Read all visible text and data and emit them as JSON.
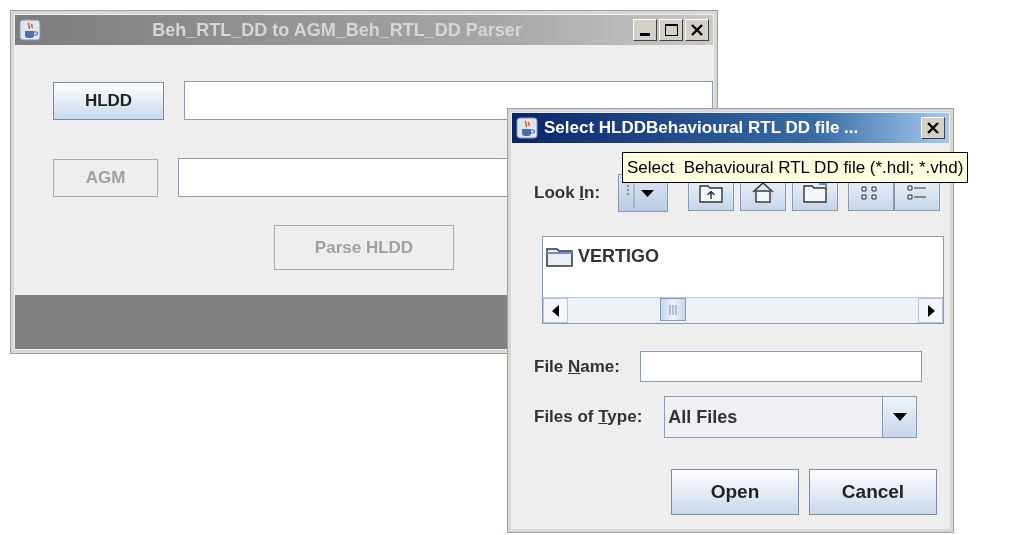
{
  "main_window": {
    "title": "Beh_RTL_DD to AGM_Beh_RTL_DD Parser",
    "active": false,
    "controls": [
      {
        "kind": "minimize"
      },
      {
        "kind": "maximize"
      },
      {
        "kind": "close"
      }
    ],
    "rows": [
      {
        "button": {
          "label": "HLDD",
          "disabled": false
        }
      },
      {
        "button": {
          "label": "AGM",
          "disabled": true
        }
      }
    ],
    "parse_button": {
      "label": "Parse HLDD",
      "disabled": true
    }
  },
  "dialog": {
    "title": "Select HLDDBehavioural RTL DD file ...",
    "active": true,
    "controls": [
      {
        "kind": "close"
      }
    ],
    "look_in": {
      "label": {
        "before": "Look ",
        "underlined": "I",
        "after": "n:"
      }
    },
    "toolbar": [
      {
        "kind": "up-folder"
      },
      {
        "kind": "home"
      },
      {
        "kind": "new-folder"
      },
      {
        "kind": "list"
      },
      {
        "kind": "details"
      }
    ],
    "files": [
      {
        "name": "VERTIGO",
        "kind": "folder"
      }
    ],
    "file_name": {
      "label": {
        "before": "File ",
        "underlined": "N",
        "after": "ame:"
      }
    },
    "file_type": {
      "label": {
        "before": "Files of ",
        "underlined": "T",
        "after": "ype:"
      },
      "value": "All Files"
    },
    "buttons": [
      "Open",
      "Cancel"
    ]
  },
  "tooltip": {
    "text": "Select  Behavioural RTL DD file (*.hdl; *.vhd)"
  }
}
